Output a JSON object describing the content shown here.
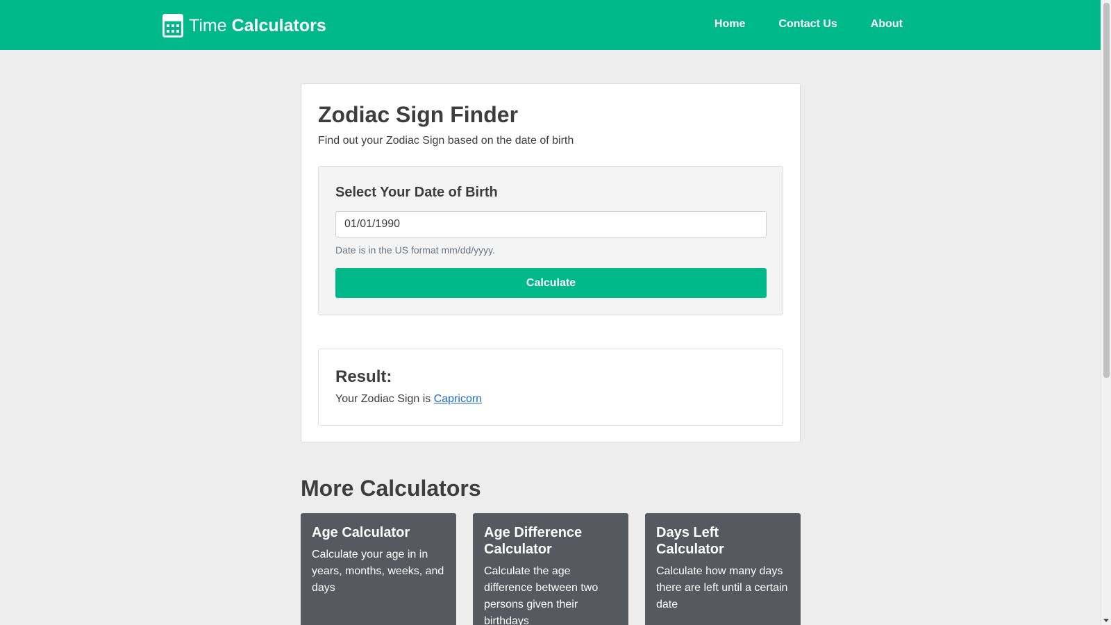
{
  "nav": {
    "brand_light": "Time",
    "brand_bold": "Calculators",
    "links": [
      "Home",
      "Contact Us",
      "About"
    ]
  },
  "main": {
    "title": "Zodiac Sign Finder",
    "subtitle": "Find out your Zodiac Sign based on the date of birth",
    "form": {
      "heading": "Select Your Date of Birth",
      "date_value": "01/01/1990",
      "hint": "Date is in the US format mm/dd/yyyy.",
      "button_label": "Calculate"
    },
    "result": {
      "heading": "Result:",
      "text_prefix": "Your Zodiac Sign is ",
      "sign": "Capricorn"
    }
  },
  "more": {
    "title": "More Calculators",
    "cards": [
      {
        "title": "Age Calculator",
        "desc": "Calculate your age in in years, months, weeks, and days"
      },
      {
        "title": "Age Difference Calculator",
        "desc": "Calculate the age difference between two persons given their birthdays"
      },
      {
        "title": "Days Left Calculator",
        "desc": "Calculate how many days there are left until a certain date"
      }
    ]
  },
  "colors": {
    "accent": "#00b98a",
    "page_bg": "#ededed",
    "card_dark": "#565a5f",
    "link": "#1a6cd1"
  },
  "icons": {
    "brand": "calculator-icon"
  }
}
